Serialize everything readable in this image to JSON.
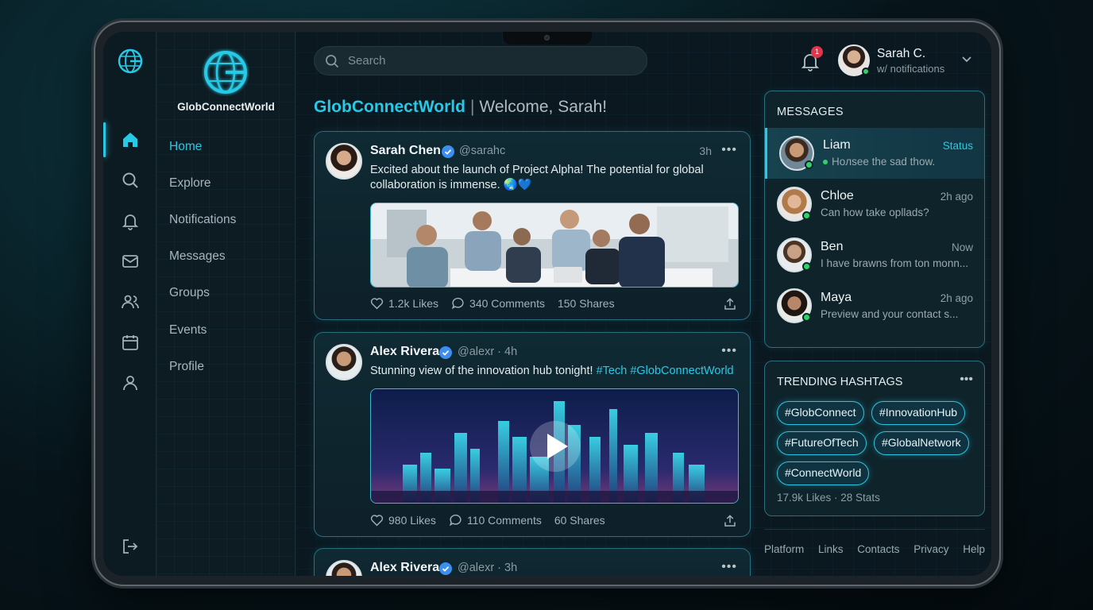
{
  "app": {
    "brand": "GlobConnectWorld",
    "welcome": "Welcome, Sarah!"
  },
  "nav": {
    "items": [
      {
        "label": "Home",
        "icon": "home-icon",
        "active": true
      },
      {
        "label": "Explore",
        "icon": "search-icon"
      },
      {
        "label": "Notifications",
        "icon": "bell-icon"
      },
      {
        "label": "Messages",
        "icon": "mail-icon"
      },
      {
        "label": "Groups",
        "icon": "users-icon"
      },
      {
        "label": "Events",
        "icon": "calendar-icon"
      },
      {
        "label": "Profile",
        "icon": "user-icon"
      }
    ],
    "logout_icon": "logout-icon"
  },
  "search": {
    "placeholder": "Search"
  },
  "header": {
    "notification_count": "1",
    "user_name": "Sarah C.",
    "user_sub": "w/ notifications"
  },
  "posts": [
    {
      "name": "Sarah Chen",
      "handle": "@sarahc",
      "time": "3h",
      "text": "Excited about the launch of Project Alpha! The potential for global collaboration is immense. 🌏💙",
      "likes": "1.2k Likes",
      "comments": "340 Comments",
      "shares": "150 Shares"
    },
    {
      "name": "Alex Rivera",
      "handle": "@alexr · 4h",
      "text_plain": "Stunning view of the innovation hub tonight!",
      "tags": [
        "#Tech",
        "#GlobConnectWorld"
      ],
      "likes": "980 Likes",
      "comments": "110 Comments",
      "shares": "60 Shares"
    },
    {
      "name": "Alex Rivera",
      "handle": "@alexr · 3h"
    }
  ],
  "messages": {
    "title": "MESSAGES",
    "items": [
      {
        "name": "Liam",
        "time": "Status",
        "preview": "Hoлsee the sad thow."
      },
      {
        "name": "Chloe",
        "time": "2h ago",
        "preview": "Can how take opllads?"
      },
      {
        "name": "Ben",
        "time": "Now",
        "preview": "I have brawns from ton monn..."
      },
      {
        "name": "Maya",
        "time": "2h ago",
        "preview": "Preview and your contact s..."
      }
    ]
  },
  "trending": {
    "title": "TRENDING HASHTAGS",
    "tags": [
      "#GlobConnect",
      "#InnovationHub",
      "#FutureOfTech",
      "#GlobalNetwork",
      "#ConnectWorld"
    ],
    "stats": "17.9k Likes · 28 Stats"
  },
  "footer": {
    "links": [
      "Platform",
      "Links",
      "Contacts",
      "Privacy",
      "Help"
    ]
  },
  "colors": {
    "accent": "#27c9e6",
    "online": "#2fd26a",
    "badge": "#e2354a",
    "verified": "#3b8ff0"
  }
}
